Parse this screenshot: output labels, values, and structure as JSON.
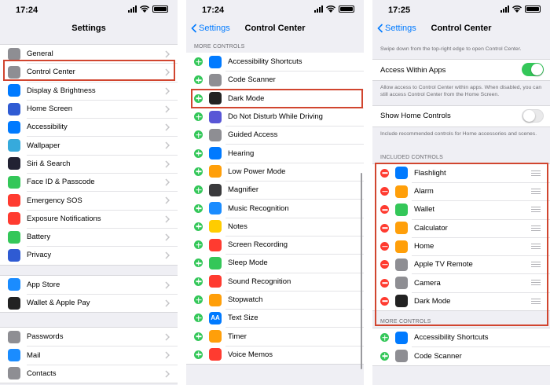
{
  "panel1": {
    "time": "17:24",
    "title": "Settings",
    "group1": [
      {
        "label": "General",
        "icon": "gear-icon",
        "color": "#8e8e93"
      },
      {
        "label": "Control Center",
        "icon": "control-center-icon",
        "color": "#8e8e93"
      },
      {
        "label": "Display & Brightness",
        "icon": "display-brightness-icon",
        "color": "#007aff"
      },
      {
        "label": "Home Screen",
        "icon": "home-screen-icon",
        "color": "#2f5bd3"
      },
      {
        "label": "Accessibility",
        "icon": "accessibility-icon",
        "color": "#007aff"
      },
      {
        "label": "Wallpaper",
        "icon": "wallpaper-icon",
        "color": "#36aadc"
      },
      {
        "label": "Siri & Search",
        "icon": "siri-icon",
        "color": "#222233"
      },
      {
        "label": "Face ID & Passcode",
        "icon": "face-id-icon",
        "color": "#34c759"
      },
      {
        "label": "Emergency SOS",
        "icon": "sos-icon",
        "color": "#ff3b30"
      },
      {
        "label": "Exposure Notifications",
        "icon": "exposure-icon",
        "color": "#ff3b30"
      },
      {
        "label": "Battery",
        "icon": "battery-icon",
        "color": "#34c759"
      },
      {
        "label": "Privacy",
        "icon": "hand-icon",
        "color": "#2f5bd3"
      }
    ],
    "group2": [
      {
        "label": "App Store",
        "icon": "app-store-icon",
        "color": "#1a8cff"
      },
      {
        "label": "Wallet & Apple Pay",
        "icon": "wallet-icon",
        "color": "#222222"
      }
    ],
    "group3": [
      {
        "label": "Passwords",
        "icon": "key-icon",
        "color": "#8e8e93"
      },
      {
        "label": "Mail",
        "icon": "mail-icon",
        "color": "#1a8cff"
      },
      {
        "label": "Contacts",
        "icon": "contacts-icon",
        "color": "#8e8e93"
      }
    ]
  },
  "panel2": {
    "time": "17:24",
    "back": "Settings",
    "title": "Control Center",
    "section": "MORE CONTROLS",
    "items": [
      {
        "label": "Accessibility Shortcuts",
        "icon": "accessibility-icon",
        "color": "#007aff"
      },
      {
        "label": "Code Scanner",
        "icon": "qr-code-icon",
        "color": "#8e8e93"
      },
      {
        "label": "Dark Mode",
        "icon": "dark-mode-icon",
        "color": "#222222"
      },
      {
        "label": "Do Not Disturb While Driving",
        "icon": "car-icon",
        "color": "#5856d6"
      },
      {
        "label": "Guided Access",
        "icon": "lock-icon",
        "color": "#8e8e93"
      },
      {
        "label": "Hearing",
        "icon": "ear-icon",
        "color": "#007aff"
      },
      {
        "label": "Low Power Mode",
        "icon": "low-power-icon",
        "color": "#ff9f0a"
      },
      {
        "label": "Magnifier",
        "icon": "magnifier-icon",
        "color": "#3a3a3c"
      },
      {
        "label": "Music Recognition",
        "icon": "shazam-icon",
        "color": "#1a8cff"
      },
      {
        "label": "Notes",
        "icon": "notes-icon",
        "color": "#ffcc00"
      },
      {
        "label": "Screen Recording",
        "icon": "record-icon",
        "color": "#ff3b30"
      },
      {
        "label": "Sleep Mode",
        "icon": "bed-icon",
        "color": "#34c759"
      },
      {
        "label": "Sound Recognition",
        "icon": "sound-recognition-icon",
        "color": "#ff3b30"
      },
      {
        "label": "Stopwatch",
        "icon": "stopwatch-icon",
        "color": "#ff9f0a"
      },
      {
        "label": "Text Size",
        "icon": "text-size-icon",
        "color": "#007aff"
      },
      {
        "label": "Timer",
        "icon": "timer-icon",
        "color": "#ff9f0a"
      },
      {
        "label": "Voice Memos",
        "icon": "voice-memo-icon",
        "color": "#ff3b30"
      }
    ],
    "text_size_glyph": "AA"
  },
  "panel3": {
    "time": "17:25",
    "back": "Settings",
    "title": "Control Center",
    "intro": "Swipe down from the top-right edge to open Control Center.",
    "access_label": "Access Within Apps",
    "access_on": true,
    "access_note": "Allow access to Control Center within apps. When disabled, you can still access Control Center from the Home Screen.",
    "home_label": "Show Home Controls",
    "home_on": false,
    "home_note": "Include recommended controls for Home accessories and scenes.",
    "included_header": "INCLUDED CONTROLS",
    "included": [
      {
        "label": "Flashlight",
        "icon": "flashlight-icon",
        "color": "#007aff"
      },
      {
        "label": "Alarm",
        "icon": "alarm-icon",
        "color": "#ff9f0a"
      },
      {
        "label": "Wallet",
        "icon": "wallet-icon",
        "color": "#34c759"
      },
      {
        "label": "Calculator",
        "icon": "calculator-icon",
        "color": "#ff9f0a"
      },
      {
        "label": "Home",
        "icon": "home-icon",
        "color": "#ff9f0a"
      },
      {
        "label": "Apple TV Remote",
        "icon": "remote-icon",
        "color": "#8e8e93"
      },
      {
        "label": "Camera",
        "icon": "camera-icon",
        "color": "#8e8e93"
      },
      {
        "label": "Dark Mode",
        "icon": "dark-mode-icon",
        "color": "#222222"
      }
    ],
    "more_header": "MORE CONTROLS",
    "more": [
      {
        "label": "Accessibility Shortcuts",
        "icon": "accessibility-icon",
        "color": "#007aff"
      },
      {
        "label": "Code Scanner",
        "icon": "qr-code-icon",
        "color": "#8e8e93"
      }
    ]
  },
  "highlight_color": "#d1452f",
  "accent_color": "#007aff"
}
